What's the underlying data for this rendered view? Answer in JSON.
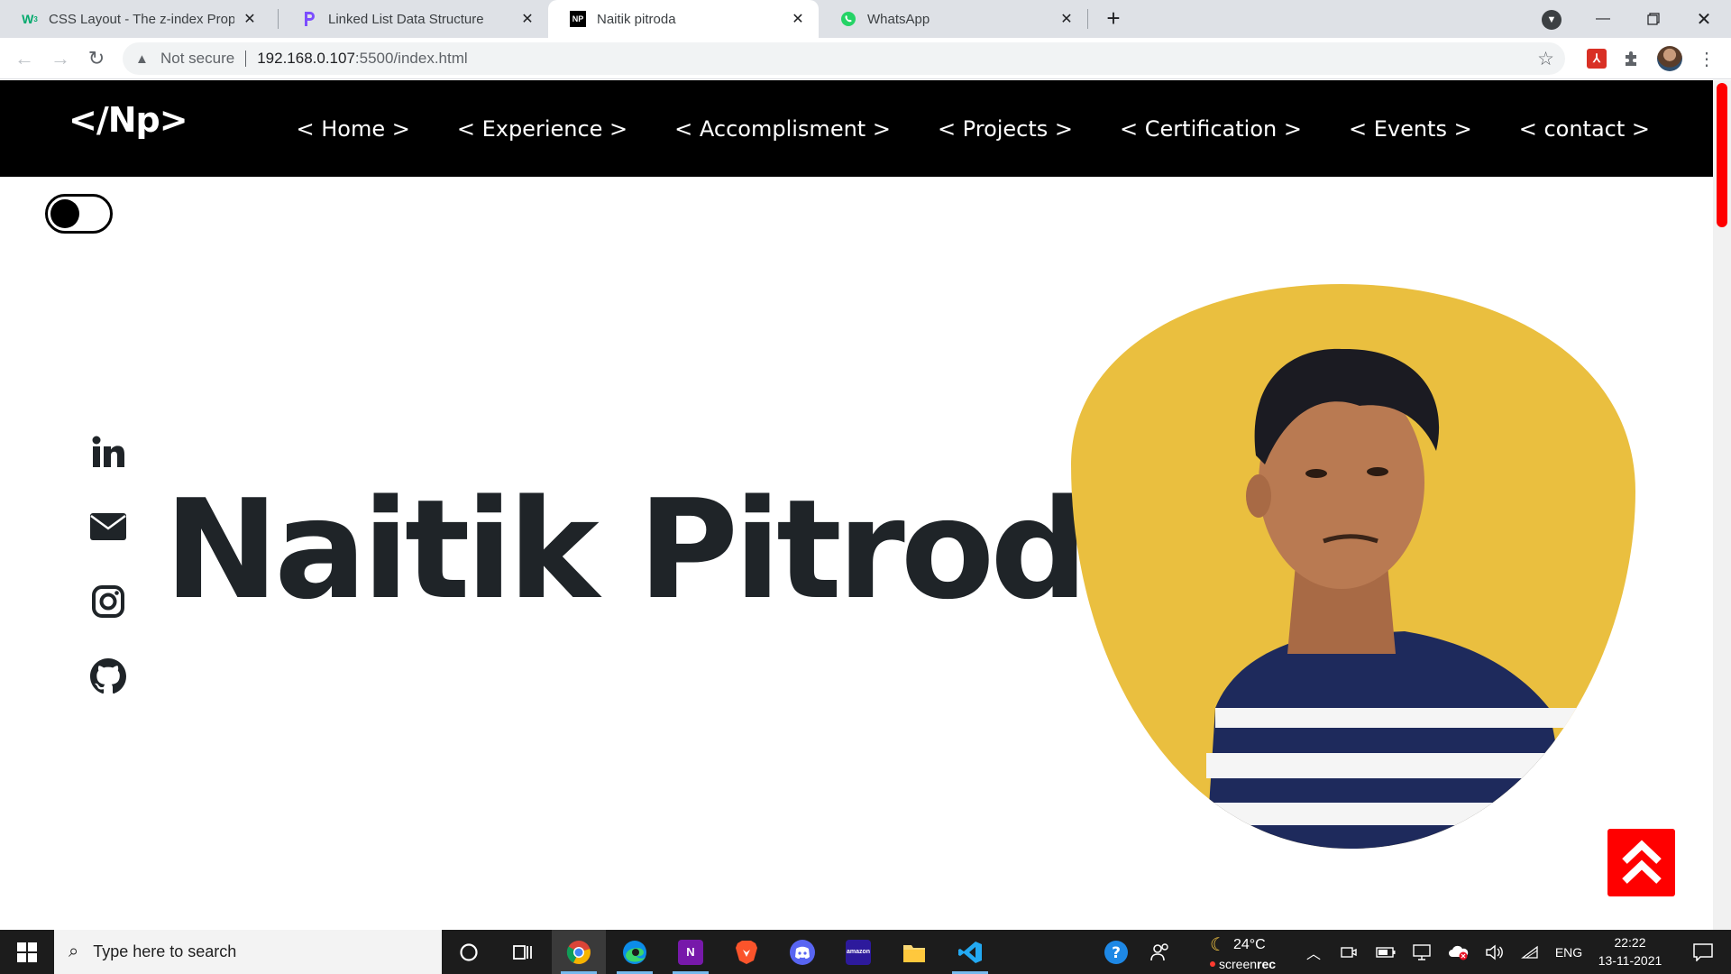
{
  "browser": {
    "tabs": [
      {
        "title": "CSS Layout - The z-index Property",
        "favicon": "w3schools-icon"
      },
      {
        "title": "Linked List Data Structure",
        "favicon": "programiz-icon"
      },
      {
        "title": "Naitik pitroda",
        "favicon": "np-icon"
      },
      {
        "title": "WhatsApp",
        "favicon": "whatsapp-icon"
      }
    ],
    "active_tab": 2,
    "address": {
      "security_label": "Not secure",
      "url_host": "192.168.0.107",
      "url_rest": ":5500/index.html"
    }
  },
  "site": {
    "logo": "</Np>",
    "nav": [
      "< Home >",
      "< Experience >",
      "< Accomplisment >",
      "< Projects >",
      "< Certification >",
      "< Events >",
      "< contact >"
    ],
    "hero_name": "Naitik Pitroda",
    "social_links": [
      "linkedin-icon",
      "mail-icon",
      "instagram-icon",
      "github-icon"
    ],
    "theme_toggle_on": false,
    "colors": {
      "nav_bg": "#000000",
      "blob": "#eabf3f",
      "accent": "#ff0000",
      "text": "#1f2428"
    }
  },
  "taskbar": {
    "search_placeholder": "Type here to search",
    "weather": "24°C",
    "recorder_label_1": "screen",
    "recorder_label_2": "rec",
    "language": "ENG",
    "time": "22:22",
    "date": "13-11-2021"
  }
}
